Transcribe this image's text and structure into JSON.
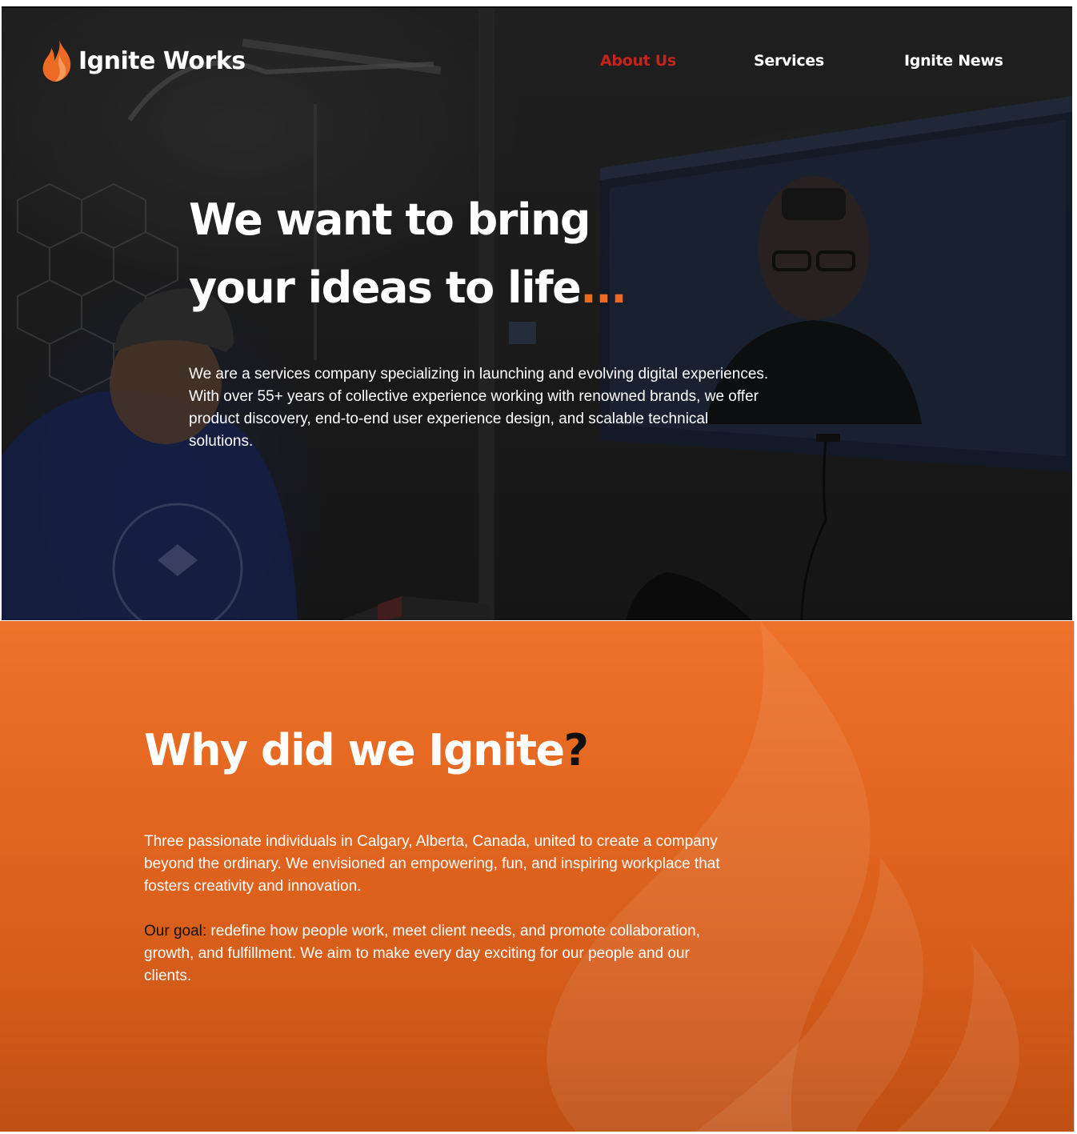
{
  "brand": {
    "name": "Ignite Works",
    "accent_color": "#ec6a23",
    "logo_icon": "flame-icon"
  },
  "nav": {
    "items": [
      {
        "label": "About Us",
        "active": true,
        "color": "#c4241c"
      },
      {
        "label": "Services",
        "active": false
      },
      {
        "label": "Ignite News",
        "active": false
      }
    ]
  },
  "hero": {
    "title_line1": "We want to bring",
    "title_line2": "your ideas to life",
    "title_ellipsis": "...",
    "description": "We are a services company specializing in launching and evolving digital experiences. With over 55+ years of collective experience working with renowned brands, we offer product discovery, end-to-end user experience design, and scalable technical solutions."
  },
  "why": {
    "title": "Why did we Ignite",
    "title_mark": "?",
    "paragraph1": "Three passionate individuals in Calgary, Alberta, Canada, united to create a company beyond the ordinary. We envisioned an empowering, fun, and inspiring workplace that fosters creativity and innovation.",
    "goal_label": "Our goal:",
    "goal_text": " redefine how people work, meet client needs, and promote collaboration, growth, and fulfillment. We aim to make every day exciting for our people and our clients.",
    "background_color": "#e2651f"
  }
}
